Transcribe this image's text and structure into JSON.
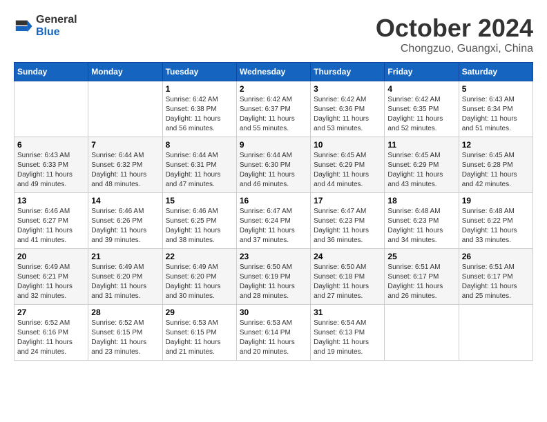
{
  "header": {
    "logo": {
      "general": "General",
      "blue": "Blue"
    },
    "title": "October 2024",
    "location": "Chongzuo, Guangxi, China"
  },
  "calendar": {
    "days_of_week": [
      "Sunday",
      "Monday",
      "Tuesday",
      "Wednesday",
      "Thursday",
      "Friday",
      "Saturday"
    ],
    "weeks": [
      [
        {
          "day": "",
          "info": ""
        },
        {
          "day": "",
          "info": ""
        },
        {
          "day": "1",
          "info": "Sunrise: 6:42 AM\nSunset: 6:38 PM\nDaylight: 11 hours\nand 56 minutes."
        },
        {
          "day": "2",
          "info": "Sunrise: 6:42 AM\nSunset: 6:37 PM\nDaylight: 11 hours\nand 55 minutes."
        },
        {
          "day": "3",
          "info": "Sunrise: 6:42 AM\nSunset: 6:36 PM\nDaylight: 11 hours\nand 53 minutes."
        },
        {
          "day": "4",
          "info": "Sunrise: 6:42 AM\nSunset: 6:35 PM\nDaylight: 11 hours\nand 52 minutes."
        },
        {
          "day": "5",
          "info": "Sunrise: 6:43 AM\nSunset: 6:34 PM\nDaylight: 11 hours\nand 51 minutes."
        }
      ],
      [
        {
          "day": "6",
          "info": "Sunrise: 6:43 AM\nSunset: 6:33 PM\nDaylight: 11 hours\nand 49 minutes."
        },
        {
          "day": "7",
          "info": "Sunrise: 6:44 AM\nSunset: 6:32 PM\nDaylight: 11 hours\nand 48 minutes."
        },
        {
          "day": "8",
          "info": "Sunrise: 6:44 AM\nSunset: 6:31 PM\nDaylight: 11 hours\nand 47 minutes."
        },
        {
          "day": "9",
          "info": "Sunrise: 6:44 AM\nSunset: 6:30 PM\nDaylight: 11 hours\nand 46 minutes."
        },
        {
          "day": "10",
          "info": "Sunrise: 6:45 AM\nSunset: 6:29 PM\nDaylight: 11 hours\nand 44 minutes."
        },
        {
          "day": "11",
          "info": "Sunrise: 6:45 AM\nSunset: 6:29 PM\nDaylight: 11 hours\nand 43 minutes."
        },
        {
          "day": "12",
          "info": "Sunrise: 6:45 AM\nSunset: 6:28 PM\nDaylight: 11 hours\nand 42 minutes."
        }
      ],
      [
        {
          "day": "13",
          "info": "Sunrise: 6:46 AM\nSunset: 6:27 PM\nDaylight: 11 hours\nand 41 minutes."
        },
        {
          "day": "14",
          "info": "Sunrise: 6:46 AM\nSunset: 6:26 PM\nDaylight: 11 hours\nand 39 minutes."
        },
        {
          "day": "15",
          "info": "Sunrise: 6:46 AM\nSunset: 6:25 PM\nDaylight: 11 hours\nand 38 minutes."
        },
        {
          "day": "16",
          "info": "Sunrise: 6:47 AM\nSunset: 6:24 PM\nDaylight: 11 hours\nand 37 minutes."
        },
        {
          "day": "17",
          "info": "Sunrise: 6:47 AM\nSunset: 6:23 PM\nDaylight: 11 hours\nand 36 minutes."
        },
        {
          "day": "18",
          "info": "Sunrise: 6:48 AM\nSunset: 6:23 PM\nDaylight: 11 hours\nand 34 minutes."
        },
        {
          "day": "19",
          "info": "Sunrise: 6:48 AM\nSunset: 6:22 PM\nDaylight: 11 hours\nand 33 minutes."
        }
      ],
      [
        {
          "day": "20",
          "info": "Sunrise: 6:49 AM\nSunset: 6:21 PM\nDaylight: 11 hours\nand 32 minutes."
        },
        {
          "day": "21",
          "info": "Sunrise: 6:49 AM\nSunset: 6:20 PM\nDaylight: 11 hours\nand 31 minutes."
        },
        {
          "day": "22",
          "info": "Sunrise: 6:49 AM\nSunset: 6:20 PM\nDaylight: 11 hours\nand 30 minutes."
        },
        {
          "day": "23",
          "info": "Sunrise: 6:50 AM\nSunset: 6:19 PM\nDaylight: 11 hours\nand 28 minutes."
        },
        {
          "day": "24",
          "info": "Sunrise: 6:50 AM\nSunset: 6:18 PM\nDaylight: 11 hours\nand 27 minutes."
        },
        {
          "day": "25",
          "info": "Sunrise: 6:51 AM\nSunset: 6:17 PM\nDaylight: 11 hours\nand 26 minutes."
        },
        {
          "day": "26",
          "info": "Sunrise: 6:51 AM\nSunset: 6:17 PM\nDaylight: 11 hours\nand 25 minutes."
        }
      ],
      [
        {
          "day": "27",
          "info": "Sunrise: 6:52 AM\nSunset: 6:16 PM\nDaylight: 11 hours\nand 24 minutes."
        },
        {
          "day": "28",
          "info": "Sunrise: 6:52 AM\nSunset: 6:15 PM\nDaylight: 11 hours\nand 23 minutes."
        },
        {
          "day": "29",
          "info": "Sunrise: 6:53 AM\nSunset: 6:15 PM\nDaylight: 11 hours\nand 21 minutes."
        },
        {
          "day": "30",
          "info": "Sunrise: 6:53 AM\nSunset: 6:14 PM\nDaylight: 11 hours\nand 20 minutes."
        },
        {
          "day": "31",
          "info": "Sunrise: 6:54 AM\nSunset: 6:13 PM\nDaylight: 11 hours\nand 19 minutes."
        },
        {
          "day": "",
          "info": ""
        },
        {
          "day": "",
          "info": ""
        }
      ]
    ]
  }
}
